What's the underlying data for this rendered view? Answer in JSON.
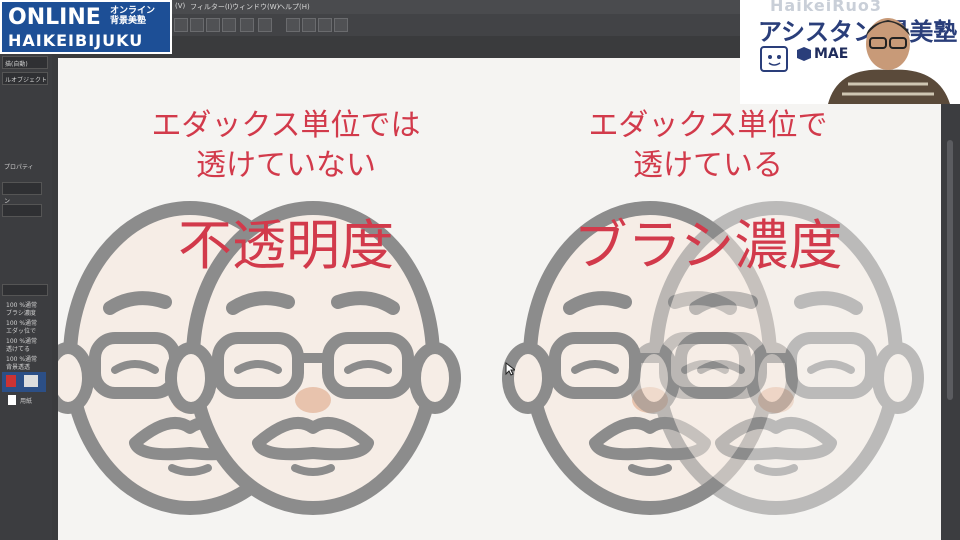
{
  "menubar": {
    "items": [
      "(V)",
      "フィルター(I)",
      "ウィンドウ(W)",
      "ヘルプ(H)"
    ]
  },
  "left_panel": {
    "dropdown1": "描(自動)",
    "dropdown2": "ルオブジェクト",
    "section_property": "プロパティ",
    "label_opacity": "ン",
    "layers": [
      {
        "line1": "100 %通常",
        "line2": "ブラシ濃度"
      },
      {
        "line1": "100 %通常",
        "line2": "エダッ位で"
      },
      {
        "line1": "100 %通常",
        "line2": "透けてる"
      },
      {
        "line1": "100 %通常",
        "line2": "背景透透"
      }
    ],
    "paper_label": "用紙"
  },
  "logo": {
    "line1": "ONLINE",
    "line1_jp_a": "オンライン",
    "line1_jp_b": "背景美塾",
    "line2": "HAIKEIBIJUKU"
  },
  "brand": {
    "top": "HaikeiRuo3",
    "title": "アシスタン  景美塾",
    "subtitle": "MAE"
  },
  "canvas": {
    "left": {
      "heading_line1": "エダックス単位では",
      "heading_line2": "透けていない",
      "big": "不透明度"
    },
    "right": {
      "heading_line1": "エダックス単位で",
      "heading_line2": "透けている",
      "big": "ブラシ濃度"
    }
  },
  "colors": {
    "heading": "#d23a4b",
    "face_stroke": "#8c8c8c",
    "face_fill": "#f6ede6",
    "nose": "#e8c3ad",
    "logo_bg": "#1d4f96",
    "brand_text": "#2a3e7a"
  }
}
